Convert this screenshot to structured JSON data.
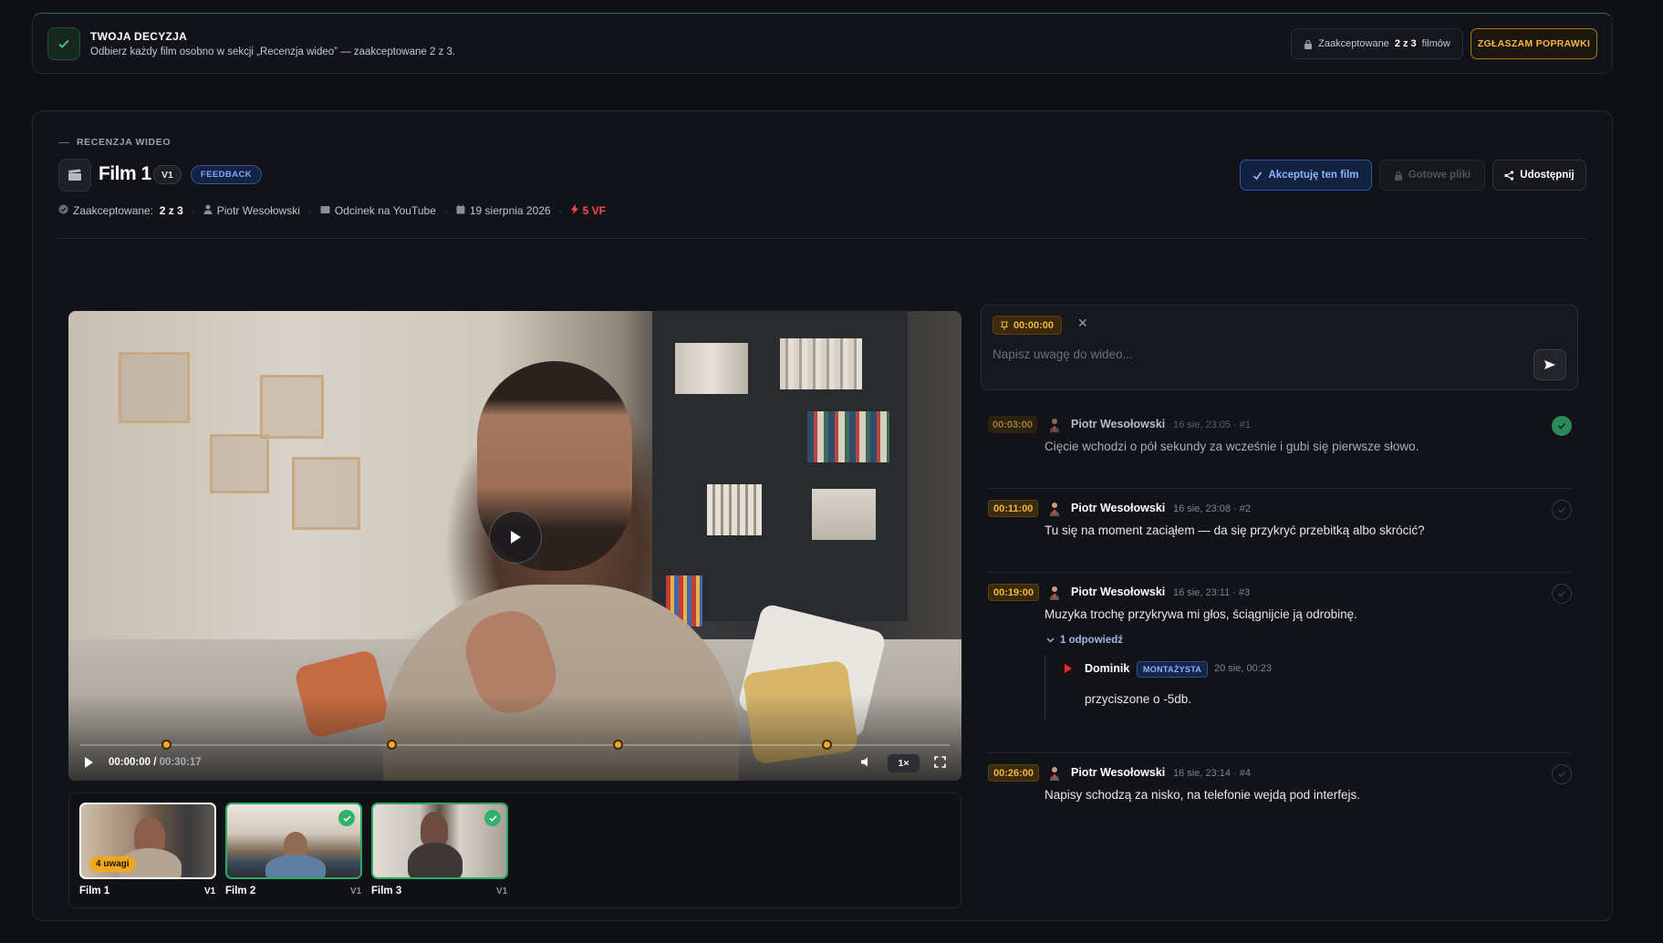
{
  "decision": {
    "title": "TWOJA DECYZJA",
    "subtitle": "Odbierz każdy film osobno w sekcji „Recenzja wideo” — zaakceptowane 2 z 3.",
    "accepted_prefix": "Zaakceptowane",
    "accepted_count": "2 z 3",
    "accepted_suffix": "filmów",
    "report_button": "ZGŁASZAM POPRAWKI"
  },
  "review": {
    "section_label": "RECENZJA WIDEO",
    "film_title": "Film 1",
    "version_badge": "V1",
    "status_badge": "FEEDBACK",
    "accept_button": "Akceptuję ten film",
    "ready_files_button": "Gotowe pliki",
    "share_button": "Udostępnij",
    "meta": {
      "accepted_label": "Zaakceptowane:",
      "accepted_value": "2 z 3",
      "author": "Piotr Wesołowski",
      "type": "Odcinek na YouTube",
      "date": "19 sierpnia 2026",
      "vf": "5 VF"
    }
  },
  "player": {
    "current_time": "00:00:00",
    "separator": "/",
    "duration": "00:30:17",
    "speed": "1×",
    "marker_fractions": [
      0.099,
      0.358,
      0.618,
      0.858
    ]
  },
  "films": [
    {
      "label": "Film 1",
      "version": "V1",
      "notes_badge": "4 uwagi",
      "accepted": false,
      "selected": true
    },
    {
      "label": "Film 2",
      "version": "V1",
      "accepted": true,
      "selected": false
    },
    {
      "label": "Film 3",
      "version": "V1",
      "accepted": true,
      "selected": false
    }
  ],
  "composer": {
    "timestamp": "00:00:00",
    "placeholder": "Napisz uwagę do wideo..."
  },
  "comments": [
    {
      "timestamp": "00:03:00",
      "author": "Piotr Wesołowski",
      "meta": "16 sie, 23:05 · #1",
      "text": "Cięcie wchodzi o pół sekundy za wcześnie i gubi się pierwsze słowo.",
      "resolved": true
    },
    {
      "timestamp": "00:11:00",
      "author": "Piotr Wesołowski",
      "meta": "16 sie, 23:08 · #2",
      "text": "Tu się na moment zaciąłem — da się przykryć przebitką albo skrócić?",
      "resolved": false
    },
    {
      "timestamp": "00:19:00",
      "author": "Piotr Wesołowski",
      "meta": "16 sie, 23:11 · #3",
      "text": "Muzyka trochę przykrywa mi głos, ściągnijcie ją odrobinę.",
      "resolved": false,
      "replies_toggle": "1 odpowiedź",
      "reply": {
        "author": "Dominik",
        "role": "MONTAŻYSTA",
        "meta": "20 sie, 00:23",
        "text": "przyciszone o -5db."
      }
    },
    {
      "timestamp": "00:26:00",
      "author": "Piotr Wesołowski",
      "meta": "16 sie, 23:14 · #4",
      "text": "Napisy schodzą za nisko, na telefonie wejdą pod interfejs.",
      "resolved": false
    }
  ],
  "colors": {
    "accent_orange": "#f5b53a",
    "accent_blue": "#8db4ff",
    "success_green": "#2fb36b",
    "danger_red": "#ff4a4a"
  }
}
